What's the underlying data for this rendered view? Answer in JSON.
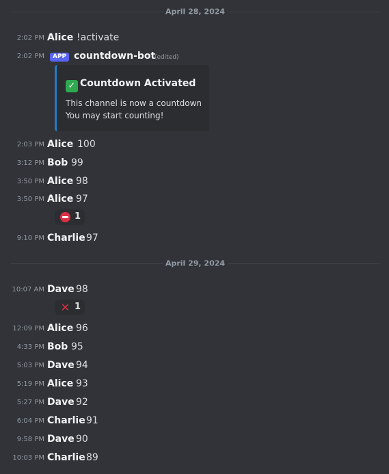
{
  "dividers": [
    "April 28, 2024",
    "April 29, 2024"
  ],
  "messages": [
    {
      "time": "2:02 PM",
      "author": "Alice",
      "content": "!activate"
    },
    {
      "time": "2:02 PM",
      "author": "countdown-bot",
      "badge": "APP",
      "edited": "(edited)"
    },
    {
      "time": "2:03 PM",
      "author": "Alice",
      "content": "100"
    },
    {
      "time": "3:12 PM",
      "author": "Bob",
      "content": "99"
    },
    {
      "time": "3:50 PM",
      "author": "Alice",
      "content": "98"
    },
    {
      "time": "3:50 PM",
      "author": "Alice",
      "content": "97"
    },
    {
      "time": "9:10 PM",
      "author": "Charlie",
      "content": "97"
    },
    {
      "time": "10:07 AM",
      "author": "Dave",
      "content": "98"
    },
    {
      "time": "12:09 PM",
      "author": "Alice",
      "content": "96"
    },
    {
      "time": "4:33 PM",
      "author": "Bob",
      "content": "95"
    },
    {
      "time": "5:03 PM",
      "author": "Dave",
      "content": "94"
    },
    {
      "time": "5:19 PM",
      "author": "Alice",
      "content": "93"
    },
    {
      "time": "5:27 PM",
      "author": "Dave",
      "content": "92"
    },
    {
      "time": "6:04 PM",
      "author": "Charlie",
      "content": "91"
    },
    {
      "time": "9:58 PM",
      "author": "Dave",
      "content": "90"
    },
    {
      "time": "10:03 PM",
      "author": "Charlie",
      "content": "89"
    }
  ],
  "embed": {
    "icon": "check-mark-icon",
    "title": "Countdown Activated",
    "line1": "This channel is now a countdown",
    "line2": "You may start counting!"
  },
  "reactions": [
    {
      "emoji": "no-entry-icon",
      "count": "1"
    },
    {
      "emoji": "cross-mark-icon",
      "count": "1"
    }
  ],
  "colors": {
    "background": "#313338",
    "badge": "#5865f2",
    "embed_accent": "#1f7fc6"
  }
}
